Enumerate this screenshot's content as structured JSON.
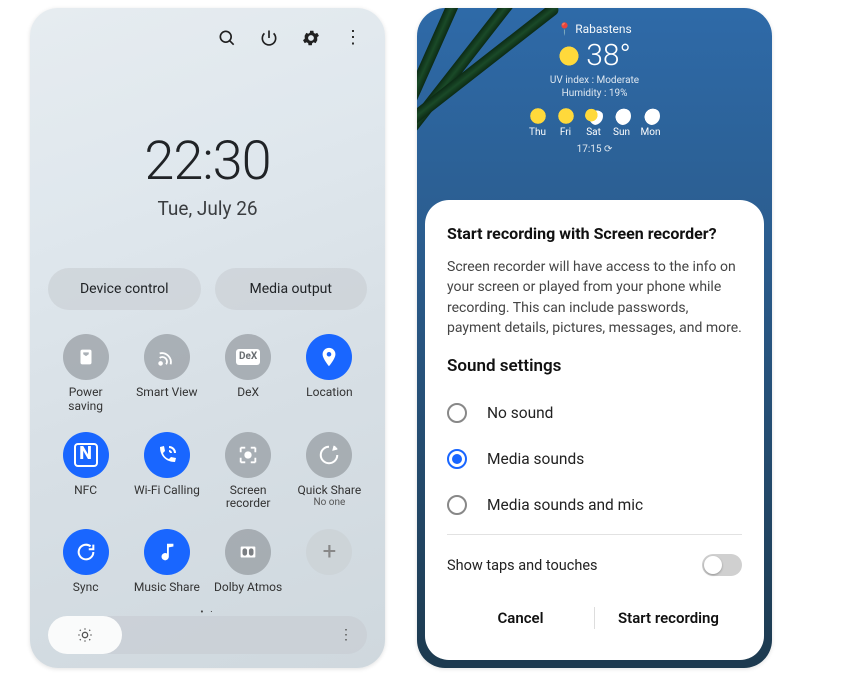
{
  "left": {
    "time": "22:30",
    "date": "Tue, July 26",
    "pills": {
      "device": "Device control",
      "media": "Media output"
    },
    "tiles": [
      {
        "label": "Power saving",
        "state": "off",
        "icon": "leaf"
      },
      {
        "label": "Smart View",
        "state": "off",
        "icon": "cast"
      },
      {
        "label": "DeX",
        "state": "off",
        "icon": "dex"
      },
      {
        "label": "Location",
        "state": "on",
        "icon": "pin"
      },
      {
        "label": "NFC",
        "state": "on",
        "icon": "nfc"
      },
      {
        "label": "Wi-Fi Calling",
        "state": "on",
        "icon": "wificall"
      },
      {
        "label": "Screen recorder",
        "state": "off",
        "icon": "rec"
      },
      {
        "label": "Quick Share",
        "state": "off",
        "icon": "share",
        "sub": "No one"
      },
      {
        "label": "Sync",
        "state": "on",
        "icon": "sync"
      },
      {
        "label": "Music Share",
        "state": "on",
        "icon": "music"
      },
      {
        "label": "Dolby Atmos",
        "state": "off",
        "icon": "dolby"
      },
      {
        "label": "",
        "state": "add",
        "icon": "plus"
      }
    ],
    "page_indicator": "• ·"
  },
  "right": {
    "weather": {
      "location": "Rabastens",
      "temp": "38°",
      "uv": "UV index : Moderate",
      "humidity": "Humidity : 19%",
      "days": [
        {
          "day": "Thu",
          "icon": "sun"
        },
        {
          "day": "Fri",
          "icon": "sun"
        },
        {
          "day": "Sat",
          "icon": "mix"
        },
        {
          "day": "Sun",
          "icon": "cld"
        },
        {
          "day": "Mon",
          "icon": "cld"
        }
      ],
      "time": "17:15 ⟳"
    },
    "dialog": {
      "title": "Start recording with Screen recorder?",
      "body": "Screen recorder will have access to the info on your screen or played from your phone while recording. This can include passwords, payment details, pictures, messages, and more.",
      "section": "Sound settings",
      "options": [
        {
          "label": "No sound",
          "selected": false
        },
        {
          "label": "Media sounds",
          "selected": true
        },
        {
          "label": "Media sounds and mic",
          "selected": false
        }
      ],
      "taps": {
        "label": "Show taps and touches",
        "on": false
      },
      "cancel": "Cancel",
      "start": "Start recording"
    }
  }
}
